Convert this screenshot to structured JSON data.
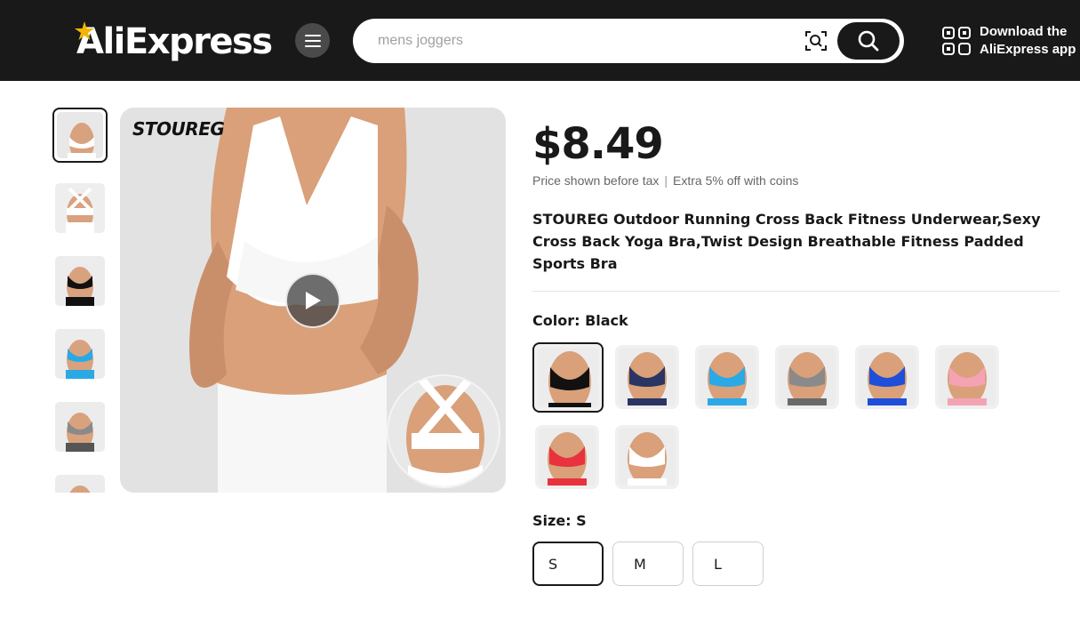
{
  "header": {
    "logo_text": "AliExpress",
    "search_placeholder": "mens joggers",
    "app_download_line1": "Download the",
    "app_download_line2": "AliExpress app",
    "icons": [
      "menu-icon",
      "camera-search-icon",
      "search-icon",
      "qr-code-icon"
    ]
  },
  "gallery": {
    "brand_mark": "STOUREG",
    "thumbnails": [
      {
        "color": "#ffffff",
        "selected": true
      },
      {
        "color": "#ffffff",
        "selected": false
      },
      {
        "color": "#111111",
        "selected": false
      },
      {
        "color": "#2aa9e6",
        "selected": false
      },
      {
        "color": "#8a8a8a",
        "selected": false
      },
      {
        "color": "#2b3563",
        "selected": false
      }
    ],
    "play_icon": "play-icon"
  },
  "product": {
    "price": "$8.49",
    "price_note": "Price shown before tax",
    "coins_note": "Extra 5% off with coins",
    "title": "STOUREG Outdoor Running Cross Back Fitness Underwear,Sexy Cross Back Yoga Bra,Twist Design Breathable Fitness Padded Sports Bra",
    "color_label": "Color: Black",
    "colors": [
      {
        "name": "Black",
        "hex": "#111111",
        "selected": true
      },
      {
        "name": "Navy",
        "hex": "#2b3563",
        "selected": false
      },
      {
        "name": "Sky Blue",
        "hex": "#2aa9e6",
        "selected": false
      },
      {
        "name": "Gray",
        "hex": "#8a8a8a",
        "selected": false
      },
      {
        "name": "Royal Blue",
        "hex": "#1f4ed8",
        "selected": false
      },
      {
        "name": "Pink",
        "hex": "#f4a3b4",
        "selected": false
      },
      {
        "name": "Red",
        "hex": "#e8323e",
        "selected": false
      },
      {
        "name": "White",
        "hex": "#ffffff",
        "selected": false
      }
    ],
    "size_label": "Size: S",
    "sizes": [
      {
        "label": "S",
        "selected": true
      },
      {
        "label": "M",
        "selected": false
      },
      {
        "label": "L",
        "selected": false
      }
    ]
  }
}
